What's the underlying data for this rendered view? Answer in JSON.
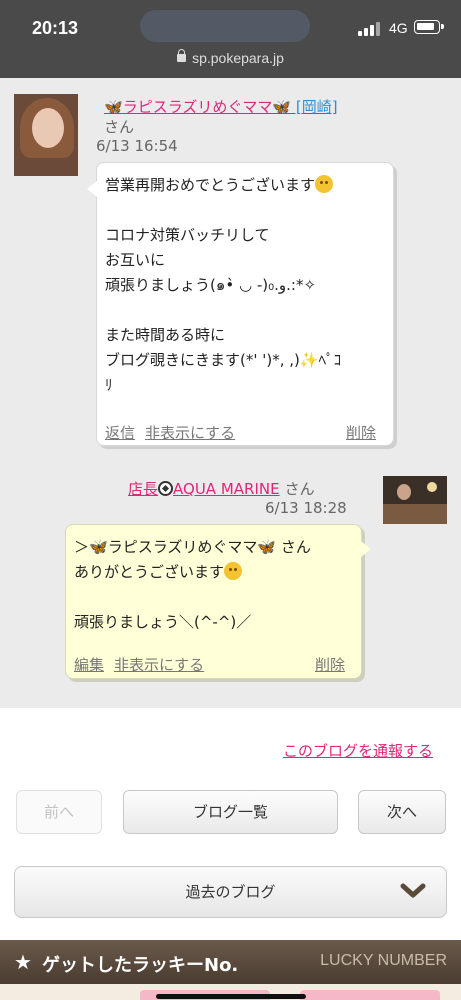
{
  "status_bar": {
    "time": "20:13",
    "network": "4G",
    "url": "sp.pokepara.jp"
  },
  "comments": [
    {
      "author_prefix": "🦋",
      "author": "ラピスラズリめぐママ",
      "author_suffix": "🦋 [岡崎]",
      "honorific": "さん",
      "date": "6/13 16:54",
      "lines": [
        "営業再開おめでとうございます",
        "",
        "コロナ対策バッチリして",
        "お互いに",
        "頑張りましょう(๑•̀ ◡ -)و.₀.:*✧",
        "",
        "また時間ある時に",
        "ブログ覗きにきます(*' ')*, ,)",
        "ﾘ"
      ],
      "line8_suffix": "ﾍﾟｺ",
      "actions": {
        "reply": "返信",
        "hide": "非表示にする",
        "delete": "削除"
      }
    },
    {
      "author_prefix": "店長",
      "author": "AQUA MARINE",
      "honorific": "さん",
      "date": "6/13 18:28",
      "line1_prefix": "＞",
      "line1_name": "ラピスラズリめぐママ",
      "line1_suffix": " さん",
      "line2": "ありがとうございます",
      "line4": "頑張りましょう＼(^-^)／",
      "actions": {
        "edit": "編集",
        "hide": "非表示にする",
        "delete": "削除"
      }
    }
  ],
  "report_link": "このブログを通報する",
  "nav": {
    "prev": "前へ",
    "list": "ブログ一覧",
    "next": "次へ"
  },
  "past_blog": "過去のブログ",
  "lucky": {
    "title": "ゲットしたラッキーNo.",
    "subtitle": "LUCKY NUMBER"
  },
  "colors": {
    "link_pink": "#e0267a",
    "bubble_yellow": "#ffffd8",
    "lucky_bar": "#5a4a3c"
  }
}
